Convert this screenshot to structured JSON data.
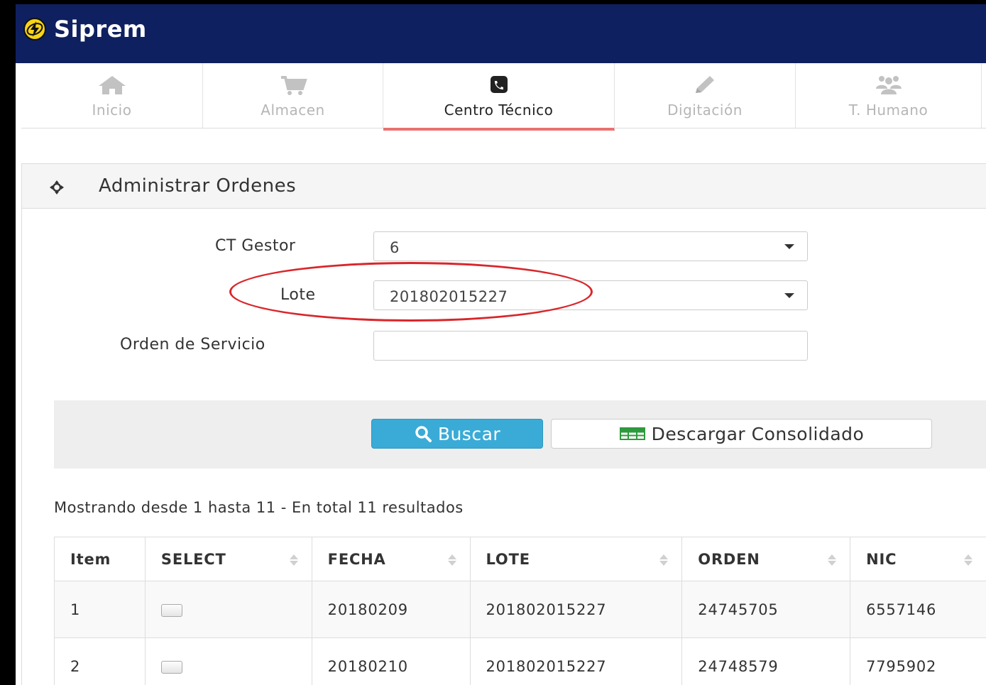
{
  "app": {
    "name": "Siprem",
    "brand_color": "#0f2060",
    "logo_icon": "lightning-bolt-icon"
  },
  "tabs": [
    {
      "label": "Inicio",
      "icon": "home-icon",
      "active": false
    },
    {
      "label": "Almacen",
      "icon": "shopping-cart-icon",
      "active": false
    },
    {
      "label": "Centro Técnico",
      "icon": "phone-icon",
      "active": true
    },
    {
      "label": "Digitación",
      "icon": "pencil-icon",
      "active": false
    },
    {
      "label": "T. Humano",
      "icon": "users-icon",
      "active": false
    }
  ],
  "panel": {
    "title": "Administrar Ordenes",
    "title_icon": "crosshair-icon"
  },
  "form": {
    "ct_gestor": {
      "label": "CT Gestor",
      "value": "6"
    },
    "lote": {
      "label": "Lote",
      "value": "201802015227"
    },
    "orden_servicio": {
      "label": "Orden de Servicio",
      "value": ""
    }
  },
  "buttons": {
    "search": {
      "label": "Buscar",
      "icon": "search-icon",
      "color": "#3aabd6"
    },
    "download": {
      "label": "Descargar Consolidado",
      "icon": "table-icon"
    }
  },
  "results": {
    "summary": "Mostrando desde 1 hasta 11 - En total 11 resultados"
  },
  "table": {
    "columns": [
      "Item",
      "SELECT",
      "FECHA",
      "LOTE",
      "ORDEN",
      "NIC"
    ],
    "rows": [
      {
        "item": "1",
        "selected": false,
        "fecha": "20180209",
        "lote": "201802015227",
        "orden": "24745705",
        "nic": "6557146"
      },
      {
        "item": "2",
        "selected": false,
        "fecha": "20180210",
        "lote": "201802015227",
        "orden": "24748579",
        "nic": "7795902"
      }
    ]
  },
  "annotation": {
    "highlight_color": "#d9262a"
  }
}
